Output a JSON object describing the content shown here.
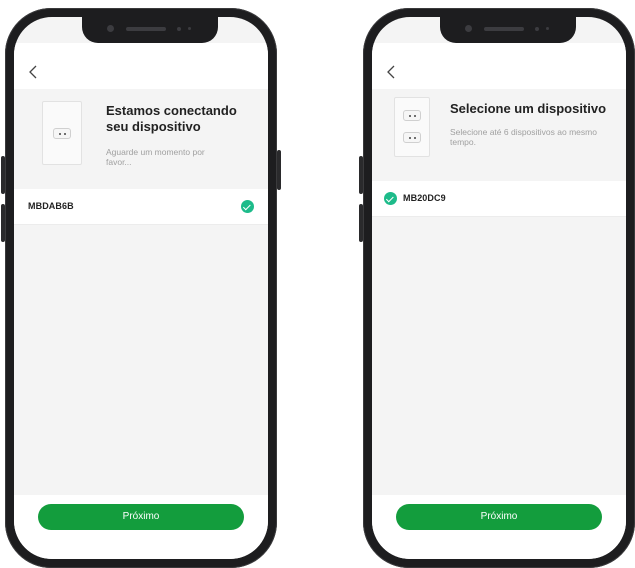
{
  "screens": [
    {
      "title": "Estamos conectando seu dispositivo",
      "subtitle": "Aguarde um momento por favor...",
      "device": {
        "name": "MBDAB6B",
        "status_icon": "check-circle-icon"
      },
      "next_label": "Próximo"
    },
    {
      "title": "Selecione um dispositivo",
      "subtitle": "Selecione até 6 dispositivos ao mesmo tempo.",
      "device": {
        "name": "MB20DC9",
        "status_icon": "check-circle-icon"
      },
      "next_label": "Próximo"
    }
  ],
  "colors": {
    "accent": "#139d3d",
    "check": "#1dbb8a"
  }
}
